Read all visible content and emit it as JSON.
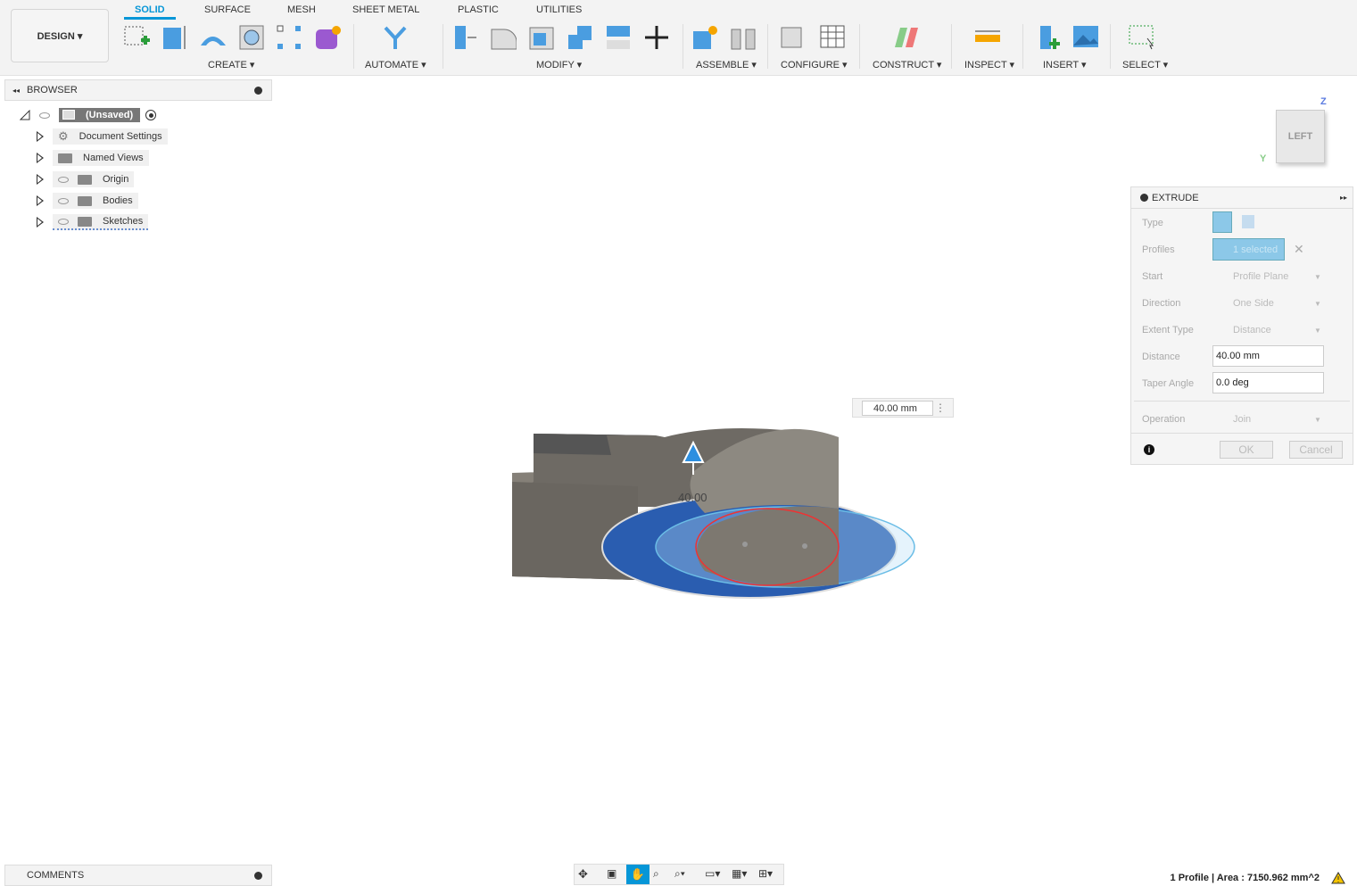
{
  "toolbar": {
    "workspace": "DESIGN ▾",
    "tabs": [
      "SOLID",
      "SURFACE",
      "MESH",
      "SHEET METAL",
      "PLASTIC",
      "UTILITIES"
    ],
    "groups": [
      "CREATE ▾",
      "AUTOMATE ▾",
      "MODIFY ▾",
      "ASSEMBLE ▾",
      "CONFIGURE ▾",
      "CONSTRUCT ▾",
      "INSPECT ▾",
      "INSERT ▾",
      "SELECT ▾"
    ]
  },
  "browser": {
    "title": "BROWSER",
    "root": "(Unsaved)",
    "items": [
      "Document Settings",
      "Named Views",
      "Origin",
      "Bodies",
      "Sketches"
    ]
  },
  "comments": {
    "title": "COMMENTS"
  },
  "viewcube": {
    "face": "LEFT",
    "axis_z": "Z",
    "axis_y": "Y"
  },
  "viewport": {
    "dimension_input": "40.00 mm",
    "dimension_label": "40.00"
  },
  "extrude": {
    "title": "EXTRUDE",
    "rows": [
      {
        "label": "Type"
      },
      {
        "label": "Profiles",
        "value": "1 selected"
      },
      {
        "label": "Start",
        "value": "Profile Plane"
      },
      {
        "label": "Direction",
        "value": "One Side"
      },
      {
        "label": "Extent Type",
        "value": "Distance"
      },
      {
        "label": "Distance",
        "value": "40.00 mm"
      },
      {
        "label": "Taper Angle",
        "value": "0.0 deg"
      },
      {
        "label": "Operation",
        "value": "Join"
      }
    ],
    "ok": "OK",
    "cancel": "Cancel"
  },
  "status": "1 Profile | Area : 7150.962 mm^2",
  "colors": {
    "accent": "#0696d7",
    "profile": "#2a5db0"
  }
}
